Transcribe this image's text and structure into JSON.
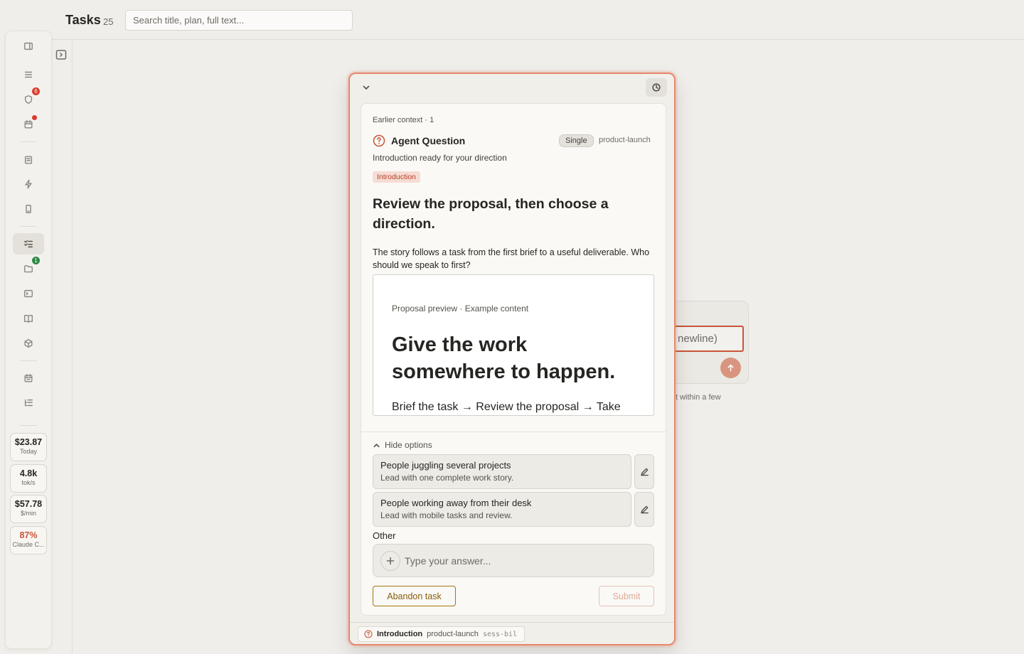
{
  "header": {
    "title": "Tasks",
    "count": "25",
    "search_placeholder": "Search title, plan, full text..."
  },
  "rail": {
    "badges": {
      "approvals": "6",
      "projects": "1"
    },
    "stats": [
      {
        "value": "$23.87",
        "label": "Today"
      },
      {
        "value": "4.8k",
        "label": "tok/s"
      },
      {
        "value": "$57.78",
        "label": "$/min"
      },
      {
        "value": "87%",
        "label": "Claude C..."
      }
    ]
  },
  "background": {
    "input_text": "newline)",
    "hint_text": "t within a few"
  },
  "modal": {
    "earlier_context": "Earlier context · 1",
    "question_title": "Agent Question",
    "mode_badge": "Single",
    "project": "product-launch",
    "subtitle": "Introduction ready for your direction",
    "tag": "Introduction",
    "headline": "Review the proposal, then choose a direction.",
    "body": "The story follows a task from the first brief to a useful deliverable. Who should we speak to first?",
    "preview": {
      "kicker": "Proposal preview · Example content",
      "headline": "Give the work somewhere to happen.",
      "flow": "Brief the task → Review the proposal → Take"
    },
    "hide_options_label": "Hide options",
    "options": [
      {
        "title": "People juggling several projects",
        "description": "Lead with one complete work story."
      },
      {
        "title": "People working away from their desk",
        "description": "Lead with mobile tasks and review."
      }
    ],
    "other_label": "Other",
    "answer_placeholder": "Type your answer...",
    "abandon_label": "Abandon task",
    "submit_label": "Submit",
    "footer": {
      "title": "Introduction",
      "project": "product-launch",
      "session": "sess-bil"
    }
  },
  "colors": {
    "accent": "#c9553a",
    "modal_border": "#e5866c",
    "tag_bg": "#f6dcd3",
    "abandon": "#a8740f"
  }
}
